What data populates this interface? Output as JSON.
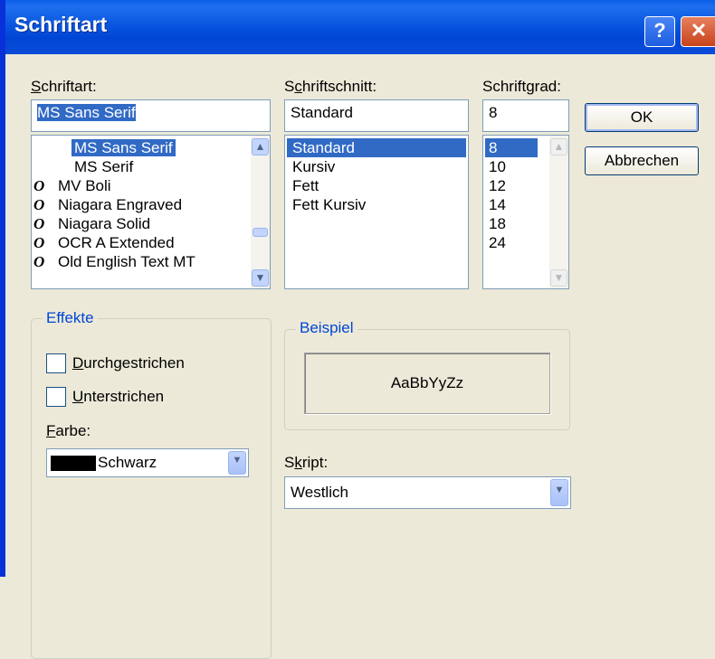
{
  "window": {
    "title": "Schriftart",
    "help_glyph": "?",
    "close_glyph": "✕"
  },
  "font": {
    "label_accel": "S",
    "label_rest": "chriftart:",
    "value": "MS Sans Serif",
    "items": [
      {
        "icon": "",
        "name": "MS Sans Serif",
        "selected": true
      },
      {
        "icon": "",
        "name": "MS Serif",
        "selected": false
      },
      {
        "icon": "O",
        "name": "MV Boli",
        "selected": false
      },
      {
        "icon": "O",
        "name": "Niagara Engraved",
        "selected": false
      },
      {
        "icon": "O",
        "name": "Niagara Solid",
        "selected": false
      },
      {
        "icon": "O",
        "name": "OCR A Extended",
        "selected": false
      },
      {
        "icon": "O",
        "name": "Old English Text MT",
        "selected": false
      }
    ]
  },
  "style": {
    "label_pre": "S",
    "label_accel": "c",
    "label_rest": "hriftschnitt:",
    "value": "Standard",
    "items": [
      "Standard",
      "Kursiv",
      "Fett",
      "Fett Kursiv"
    ],
    "selected_index": 0
  },
  "size": {
    "label_pre": "Schrift",
    "label_accel": "g",
    "label_rest": "rad:",
    "value": "8",
    "items": [
      "8",
      "10",
      "12",
      "14",
      "18",
      "24"
    ],
    "selected_index": 0
  },
  "buttons": {
    "ok": "OK",
    "cancel": "Abbrechen"
  },
  "effects": {
    "legend": "Effekte",
    "strike_accel": "D",
    "strike_rest": "urchgestrichen",
    "underline_accel": "U",
    "underline_rest": "nterstrichen",
    "color_accel": "F",
    "color_rest": "arbe:",
    "color_value": "Schwarz"
  },
  "sample": {
    "legend": "Beispiel",
    "text": "AaBbYyZz"
  },
  "script": {
    "label_pre": "S",
    "label_accel": "k",
    "label_rest": "ript:",
    "value": "Westlich"
  },
  "colors": {
    "selection": "#316ac5",
    "titlebar": "#0a57e0",
    "group_label": "#0046d5"
  }
}
